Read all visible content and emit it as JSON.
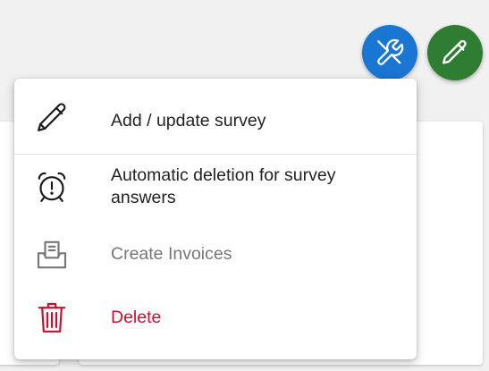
{
  "toolbar": {
    "tools_button": {
      "icon": "tools-icon",
      "color": "#1976d2"
    },
    "edit_button": {
      "icon": "pencil-icon",
      "color": "#2e7d32"
    }
  },
  "menu": {
    "items": [
      {
        "label": "Add / update survey",
        "icon": "pencil-icon",
        "state": "enabled"
      },
      {
        "label": "Automatic deletion for survey answers",
        "icon": "alarm-clock-alert-icon",
        "state": "enabled"
      },
      {
        "label": "Create Invoices",
        "icon": "inbox-document-icon",
        "state": "disabled",
        "color": "#777777"
      },
      {
        "label": "Delete",
        "icon": "trash-icon",
        "state": "danger",
        "color": "#c8102e"
      }
    ]
  }
}
